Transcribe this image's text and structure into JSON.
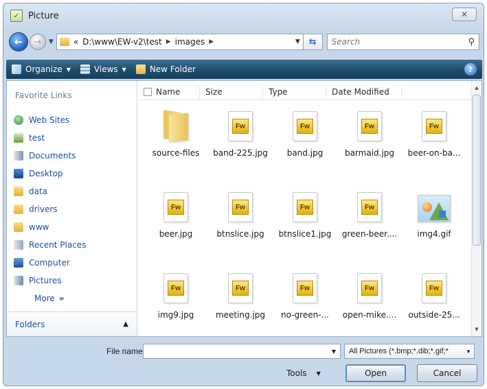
{
  "window": {
    "title": "Picture",
    "close_glyph": "✕"
  },
  "address": {
    "prefix": "«",
    "crumbs": [
      "D:\\www\\EW-v2\\test",
      "images"
    ],
    "search_placeholder": "Search"
  },
  "toolbar": {
    "organize": "Organize",
    "views": "Views",
    "new_folder": "New Folder",
    "help": "?"
  },
  "nav": {
    "heading": "Favorite Links",
    "items": [
      "Web Sites",
      "test",
      "Documents",
      "Desktop",
      "data",
      "drivers",
      "www",
      "Recent Places",
      "Computer",
      "Pictures"
    ],
    "more": "More",
    "more_glyph": "»",
    "folders": "Folders"
  },
  "columns": [
    "Name",
    "Size",
    "Type",
    "Date Modified"
  ],
  "files": [
    {
      "name": "source-files",
      "kind": "folder"
    },
    {
      "name": "band-225.jpg",
      "kind": "fw"
    },
    {
      "name": "band.jpg",
      "kind": "fw"
    },
    {
      "name": "barmaid.jpg",
      "kind": "fw"
    },
    {
      "name": "beer-on-ba...",
      "kind": "fw"
    },
    {
      "name": "beer.jpg",
      "kind": "fw"
    },
    {
      "name": "btnslice.jpg",
      "kind": "fw"
    },
    {
      "name": "btnslice1.jpg",
      "kind": "fw"
    },
    {
      "name": "green-beer....",
      "kind": "fw"
    },
    {
      "name": "img4.gif",
      "kind": "gif"
    },
    {
      "name": "img9.jpg",
      "kind": "fw"
    },
    {
      "name": "meeting.jpg",
      "kind": "fw"
    },
    {
      "name": "no-green-...",
      "kind": "fw"
    },
    {
      "name": "open-mike....",
      "kind": "fw"
    },
    {
      "name": "outside-25...",
      "kind": "fw"
    }
  ],
  "fw_badge_text": "Fw",
  "bottom": {
    "file_name_label": "File name:",
    "file_name_value": "",
    "filter": "All Pictures (*.bmp;*.dib;*.gif;*",
    "tools": "Tools",
    "open": "Open",
    "cancel": "Cancel"
  }
}
